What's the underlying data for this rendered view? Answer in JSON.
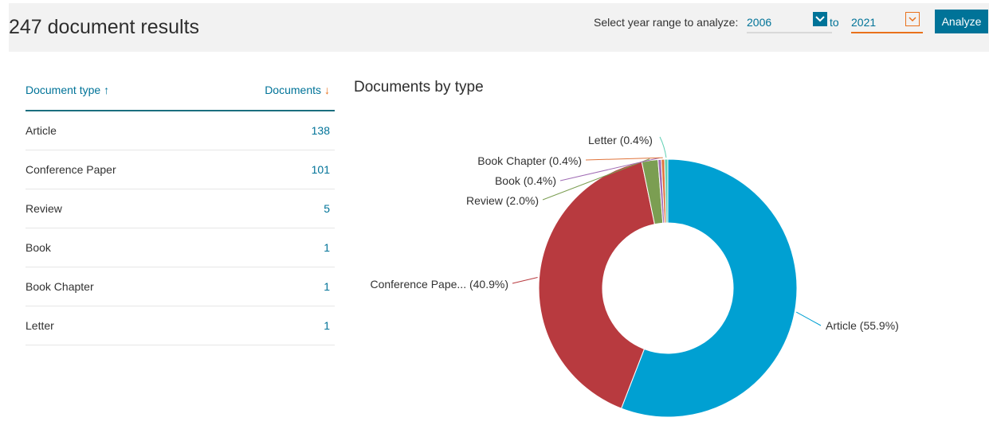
{
  "header": {
    "results_title": "247 document results",
    "range_label": "Select year range to analyze:",
    "year_from": "2006",
    "to_label": "to",
    "year_to": "2021",
    "analyze_label": "Analyze"
  },
  "table": {
    "col_type": "Document type",
    "col_type_arrow": "↑",
    "col_docs": "Documents",
    "col_docs_arrow": "↓",
    "rows": [
      {
        "type": "Article",
        "count": "138"
      },
      {
        "type": "Conference Paper",
        "count": "101"
      },
      {
        "type": "Review",
        "count": "5"
      },
      {
        "type": "Book",
        "count": "1"
      },
      {
        "type": "Book Chapter",
        "count": "1"
      },
      {
        "type": "Letter",
        "count": "1"
      }
    ]
  },
  "chart_data": {
    "type": "pie",
    "title": "Documents by type",
    "categories": [
      "Article",
      "Conference Paper",
      "Review",
      "Book",
      "Book Chapter",
      "Letter"
    ],
    "values": [
      138,
      101,
      5,
      1,
      1,
      1
    ],
    "labels": [
      "Article (55.9%)",
      "Conference Pape... (40.9%)",
      "Review (2.0%)",
      "Book (0.4%)",
      "Book Chapter (0.4%)",
      "Letter (0.4%)"
    ],
    "colors": [
      "#00a0d2",
      "#b83a3f",
      "#7b9e52",
      "#a06cb4",
      "#e0733a",
      "#5fd0b4"
    ],
    "donut": true
  },
  "colors": {
    "accent": "#007398",
    "from_select_line": "#d9d9d9",
    "to_select_line": "#e9711c",
    "from_chevron_bg": "#007398",
    "to_chevron_border": "#e9711c"
  },
  "icons": {
    "from_select": "chevron-down-icon",
    "to_select": "chevron-down-icon",
    "sort_asc": "arrow-up-icon",
    "sort_desc": "arrow-down-icon"
  }
}
